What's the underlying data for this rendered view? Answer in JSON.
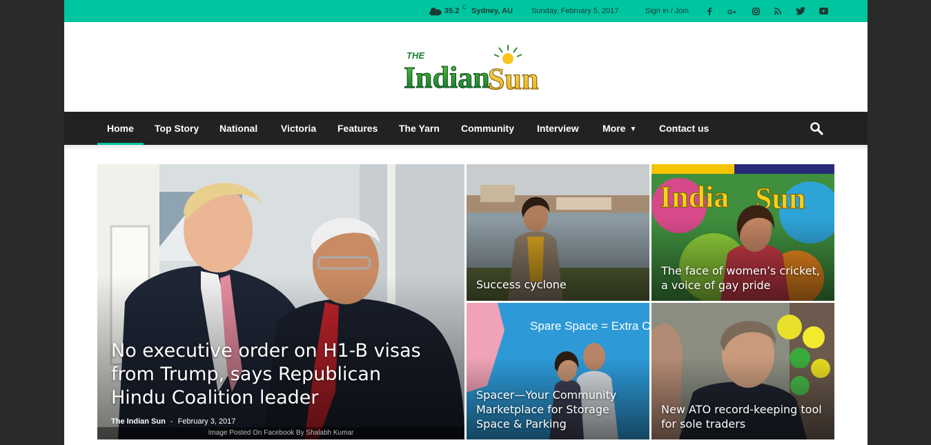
{
  "topbar": {
    "temperature": "35.2",
    "temp_unit": "C",
    "city": "Sydney, AU",
    "date": "Sunday, February 5, 2017",
    "signin": "Sign in / Join",
    "social_icons": [
      "facebook-icon",
      "google-plus-icon",
      "instagram-icon",
      "rss-icon",
      "twitter-icon",
      "youtube-icon"
    ]
  },
  "header": {
    "logo_text": "The Indian Sun"
  },
  "nav": {
    "items": [
      "Home",
      "Top Story",
      "National",
      "Victoria",
      "Features",
      "The Yarn",
      "Community",
      "Interview",
      "More",
      "Contact us"
    ],
    "active": "Home"
  },
  "featured": {
    "big": {
      "title": "No executive order on H1-B visas from Trump, says Republican Hindu Coalition leader",
      "author": "The Indian Sun",
      "separator": "-",
      "date": "February 3, 2017",
      "caption": "Image Posted On Facebook By Shalabh Kumar"
    },
    "tiles": [
      {
        "title": "Success cyclone"
      },
      {
        "title": "The face of women’s cricket, a voice of gay pride"
      },
      {
        "title": "Spacer—Your Community Marketplace for Storage Space & Parking"
      },
      {
        "title": "New ATO record-keeping tool for sole traders"
      }
    ],
    "tile3_banner": "Spare Space = Extra Ca"
  },
  "colors": {
    "accent": "#00c6a0",
    "nav_bg": "#222222",
    "page_bg": "#2a2a2a"
  }
}
